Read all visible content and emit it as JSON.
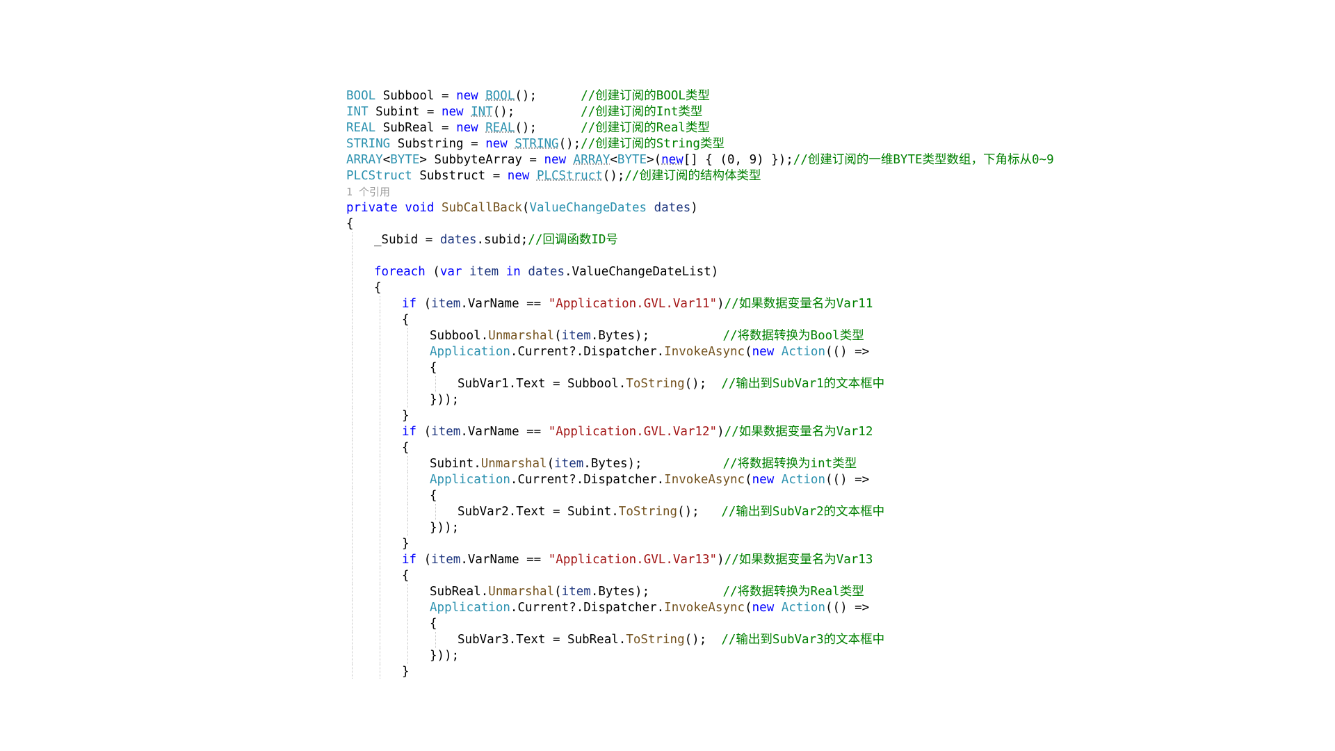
{
  "colors": {
    "keyword": "#0000ff",
    "type": "#2b91af",
    "string": "#a31515",
    "comment": "#008000",
    "method": "#74531f",
    "identifier": "#1f377f",
    "plain": "#000000",
    "reference": "#9a9a9a",
    "background": "#ffffff"
  },
  "code": {
    "lines": [
      {
        "indent": 0,
        "tokens": [
          {
            "t": "BOOL",
            "c": "ty"
          },
          {
            "t": " Subbool = ",
            "c": "pl"
          },
          {
            "t": "new",
            "c": "kw"
          },
          {
            "t": " ",
            "c": "pl"
          },
          {
            "t": "BOOL",
            "c": "ty",
            "sq": true
          },
          {
            "t": "();      ",
            "c": "pl"
          },
          {
            "t": "//创建订阅的BOOL类型",
            "c": "cm"
          }
        ]
      },
      {
        "indent": 0,
        "tokens": [
          {
            "t": "INT",
            "c": "ty"
          },
          {
            "t": " Subint = ",
            "c": "pl"
          },
          {
            "t": "new",
            "c": "kw"
          },
          {
            "t": " ",
            "c": "pl"
          },
          {
            "t": "INT",
            "c": "ty",
            "sq": true
          },
          {
            "t": "();         ",
            "c": "pl"
          },
          {
            "t": "//创建订阅的Int类型",
            "c": "cm"
          }
        ]
      },
      {
        "indent": 0,
        "tokens": [
          {
            "t": "REAL",
            "c": "ty"
          },
          {
            "t": " SubReal = ",
            "c": "pl"
          },
          {
            "t": "new",
            "c": "kw"
          },
          {
            "t": " ",
            "c": "pl"
          },
          {
            "t": "REAL",
            "c": "ty",
            "sq": true
          },
          {
            "t": "();      ",
            "c": "pl"
          },
          {
            "t": "//创建订阅的Real类型",
            "c": "cm"
          }
        ]
      },
      {
        "indent": 0,
        "tokens": [
          {
            "t": "STRING",
            "c": "ty"
          },
          {
            "t": " Substring = ",
            "c": "pl"
          },
          {
            "t": "new",
            "c": "kw"
          },
          {
            "t": " ",
            "c": "pl"
          },
          {
            "t": "STRING",
            "c": "ty",
            "sq": true
          },
          {
            "t": "();",
            "c": "pl"
          },
          {
            "t": "//创建订阅的String类型",
            "c": "cm"
          }
        ]
      },
      {
        "indent": 0,
        "tokens": [
          {
            "t": "ARRAY",
            "c": "ty"
          },
          {
            "t": "<",
            "c": "pl"
          },
          {
            "t": "BYTE",
            "c": "ty"
          },
          {
            "t": "> SubbyteArray = ",
            "c": "pl"
          },
          {
            "t": "new",
            "c": "kw"
          },
          {
            "t": " ",
            "c": "pl"
          },
          {
            "t": "ARRAY",
            "c": "ty",
            "sq": true
          },
          {
            "t": "<",
            "c": "pl"
          },
          {
            "t": "BYTE",
            "c": "ty"
          },
          {
            "t": ">(",
            "c": "pl"
          },
          {
            "t": "new",
            "c": "kw",
            "sq": true
          },
          {
            "t": "[] { (0, 9) });",
            "c": "pl"
          },
          {
            "t": "//创建订阅的一维BYTE类型数组，下角标从0~9",
            "c": "cm"
          }
        ]
      },
      {
        "indent": 0,
        "tokens": [
          {
            "t": "PLCStruct",
            "c": "ty"
          },
          {
            "t": " Substruct = ",
            "c": "pl"
          },
          {
            "t": "new",
            "c": "kw"
          },
          {
            "t": " ",
            "c": "pl"
          },
          {
            "t": "PLCStruct",
            "c": "ty",
            "sq": true
          },
          {
            "t": "();",
            "c": "pl"
          },
          {
            "t": "//创建订阅的结构体类型",
            "c": "cm"
          }
        ]
      },
      {
        "indent": 0,
        "tokens": [
          {
            "t": "1 个引用",
            "c": "ref"
          }
        ]
      },
      {
        "indent": 0,
        "tokens": [
          {
            "t": "private",
            "c": "kw"
          },
          {
            "t": " ",
            "c": "pl"
          },
          {
            "t": "void",
            "c": "kw"
          },
          {
            "t": " ",
            "c": "pl"
          },
          {
            "t": "SubCallBack",
            "c": "fn"
          },
          {
            "t": "(",
            "c": "pl"
          },
          {
            "t": "ValueChangeDates",
            "c": "ty"
          },
          {
            "t": " ",
            "c": "pl"
          },
          {
            "t": "dates",
            "c": "id"
          },
          {
            "t": ")",
            "c": "pl"
          }
        ]
      },
      {
        "indent": 0,
        "tokens": [
          {
            "t": "{",
            "c": "pl"
          }
        ]
      },
      {
        "indent": 1,
        "tokens": [
          {
            "t": "_Subid = ",
            "c": "pl"
          },
          {
            "t": "dates",
            "c": "id"
          },
          {
            "t": ".subid;",
            "c": "pl"
          },
          {
            "t": "//回调函数ID号",
            "c": "cm"
          }
        ]
      },
      {
        "indent": 1,
        "tokens": []
      },
      {
        "indent": 1,
        "tokens": [
          {
            "t": "foreach",
            "c": "kw"
          },
          {
            "t": " (",
            "c": "pl"
          },
          {
            "t": "var",
            "c": "kw"
          },
          {
            "t": " ",
            "c": "pl"
          },
          {
            "t": "item",
            "c": "id"
          },
          {
            "t": " ",
            "c": "pl"
          },
          {
            "t": "in",
            "c": "kw"
          },
          {
            "t": " ",
            "c": "pl"
          },
          {
            "t": "dates",
            "c": "id"
          },
          {
            "t": ".ValueChangeDateList)",
            "c": "pl"
          }
        ]
      },
      {
        "indent": 1,
        "tokens": [
          {
            "t": "{",
            "c": "pl"
          }
        ]
      },
      {
        "indent": 2,
        "tokens": [
          {
            "t": "if",
            "c": "kw"
          },
          {
            "t": " (",
            "c": "pl"
          },
          {
            "t": "item",
            "c": "id"
          },
          {
            "t": ".VarName == ",
            "c": "pl"
          },
          {
            "t": "\"Application.GVL.Var11\"",
            "c": "str"
          },
          {
            "t": ")",
            "c": "pl"
          },
          {
            "t": "//如果数据变量名为Var11",
            "c": "cm"
          }
        ]
      },
      {
        "indent": 2,
        "tokens": [
          {
            "t": "{",
            "c": "pl"
          }
        ]
      },
      {
        "indent": 3,
        "tokens": [
          {
            "t": "Subbool.",
            "c": "pl"
          },
          {
            "t": "Unmarshal",
            "c": "fn"
          },
          {
            "t": "(",
            "c": "pl"
          },
          {
            "t": "item",
            "c": "id"
          },
          {
            "t": ".Bytes);          ",
            "c": "pl"
          },
          {
            "t": "//将数据转换为Bool类型",
            "c": "cm"
          }
        ]
      },
      {
        "indent": 3,
        "tokens": [
          {
            "t": "Application",
            "c": "ty"
          },
          {
            "t": ".Current?.Dispatcher.",
            "c": "pl"
          },
          {
            "t": "InvokeAsync",
            "c": "fn"
          },
          {
            "t": "(",
            "c": "pl"
          },
          {
            "t": "new",
            "c": "kw"
          },
          {
            "t": " ",
            "c": "pl"
          },
          {
            "t": "Action",
            "c": "ty"
          },
          {
            "t": "(() =>",
            "c": "pl"
          }
        ]
      },
      {
        "indent": 3,
        "tokens": [
          {
            "t": "{",
            "c": "pl"
          }
        ]
      },
      {
        "indent": 4,
        "tokens": [
          {
            "t": "SubVar1.Text = Subbool.",
            "c": "pl"
          },
          {
            "t": "ToString",
            "c": "fn"
          },
          {
            "t": "();  ",
            "c": "pl"
          },
          {
            "t": "//输出到SubVar1的文本框中",
            "c": "cm"
          }
        ]
      },
      {
        "indent": 3,
        "tokens": [
          {
            "t": "}));",
            "c": "pl"
          }
        ]
      },
      {
        "indent": 2,
        "tokens": [
          {
            "t": "}",
            "c": "pl"
          }
        ]
      },
      {
        "indent": 2,
        "tokens": [
          {
            "t": "if",
            "c": "kw"
          },
          {
            "t": " (",
            "c": "pl"
          },
          {
            "t": "item",
            "c": "id"
          },
          {
            "t": ".VarName == ",
            "c": "pl"
          },
          {
            "t": "\"Application.GVL.Var12\"",
            "c": "str"
          },
          {
            "t": ")",
            "c": "pl"
          },
          {
            "t": "//如果数据变量名为Var12",
            "c": "cm"
          }
        ]
      },
      {
        "indent": 2,
        "tokens": [
          {
            "t": "{",
            "c": "pl"
          }
        ]
      },
      {
        "indent": 3,
        "tokens": [
          {
            "t": "Subint.",
            "c": "pl"
          },
          {
            "t": "Unmarshal",
            "c": "fn"
          },
          {
            "t": "(",
            "c": "pl"
          },
          {
            "t": "item",
            "c": "id"
          },
          {
            "t": ".Bytes);           ",
            "c": "pl"
          },
          {
            "t": "//将数据转换为int类型",
            "c": "cm"
          }
        ]
      },
      {
        "indent": 3,
        "tokens": [
          {
            "t": "Application",
            "c": "ty"
          },
          {
            "t": ".Current?.Dispatcher.",
            "c": "pl"
          },
          {
            "t": "InvokeAsync",
            "c": "fn"
          },
          {
            "t": "(",
            "c": "pl"
          },
          {
            "t": "new",
            "c": "kw"
          },
          {
            "t": " ",
            "c": "pl"
          },
          {
            "t": "Action",
            "c": "ty"
          },
          {
            "t": "(() =>",
            "c": "pl"
          }
        ]
      },
      {
        "indent": 3,
        "tokens": [
          {
            "t": "{",
            "c": "pl"
          }
        ]
      },
      {
        "indent": 4,
        "tokens": [
          {
            "t": "SubVar2.Text = Subint.",
            "c": "pl"
          },
          {
            "t": "ToString",
            "c": "fn"
          },
          {
            "t": "();   ",
            "c": "pl"
          },
          {
            "t": "//输出到SubVar2的文本框中",
            "c": "cm"
          }
        ]
      },
      {
        "indent": 3,
        "tokens": [
          {
            "t": "}));",
            "c": "pl"
          }
        ]
      },
      {
        "indent": 2,
        "tokens": [
          {
            "t": "}",
            "c": "pl"
          }
        ]
      },
      {
        "indent": 2,
        "tokens": [
          {
            "t": "if",
            "c": "kw"
          },
          {
            "t": " (",
            "c": "pl"
          },
          {
            "t": "item",
            "c": "id"
          },
          {
            "t": ".VarName == ",
            "c": "pl"
          },
          {
            "t": "\"Application.GVL.Var13\"",
            "c": "str"
          },
          {
            "t": ")",
            "c": "pl"
          },
          {
            "t": "//如果数据变量名为Var13",
            "c": "cm"
          }
        ]
      },
      {
        "indent": 2,
        "tokens": [
          {
            "t": "{",
            "c": "pl"
          }
        ]
      },
      {
        "indent": 3,
        "tokens": [
          {
            "t": "SubReal.",
            "c": "pl"
          },
          {
            "t": "Unmarshal",
            "c": "fn"
          },
          {
            "t": "(",
            "c": "pl"
          },
          {
            "t": "item",
            "c": "id"
          },
          {
            "t": ".Bytes);          ",
            "c": "pl"
          },
          {
            "t": "//将数据转换为Real类型",
            "c": "cm"
          }
        ]
      },
      {
        "indent": 3,
        "tokens": [
          {
            "t": "Application",
            "c": "ty"
          },
          {
            "t": ".Current?.Dispatcher.",
            "c": "pl"
          },
          {
            "t": "InvokeAsync",
            "c": "fn"
          },
          {
            "t": "(",
            "c": "pl"
          },
          {
            "t": "new",
            "c": "kw"
          },
          {
            "t": " ",
            "c": "pl"
          },
          {
            "t": "Action",
            "c": "ty"
          },
          {
            "t": "(() =>",
            "c": "pl"
          }
        ]
      },
      {
        "indent": 3,
        "tokens": [
          {
            "t": "{",
            "c": "pl"
          }
        ]
      },
      {
        "indent": 4,
        "tokens": [
          {
            "t": "SubVar3.Text = SubReal.",
            "c": "pl"
          },
          {
            "t": "ToString",
            "c": "fn"
          },
          {
            "t": "();  ",
            "c": "pl"
          },
          {
            "t": "//输出到SubVar3的文本框中",
            "c": "cm"
          }
        ]
      },
      {
        "indent": 3,
        "tokens": [
          {
            "t": "}));",
            "c": "pl"
          }
        ]
      },
      {
        "indent": 2,
        "tokens": [
          {
            "t": "}",
            "c": "pl"
          }
        ]
      }
    ]
  }
}
